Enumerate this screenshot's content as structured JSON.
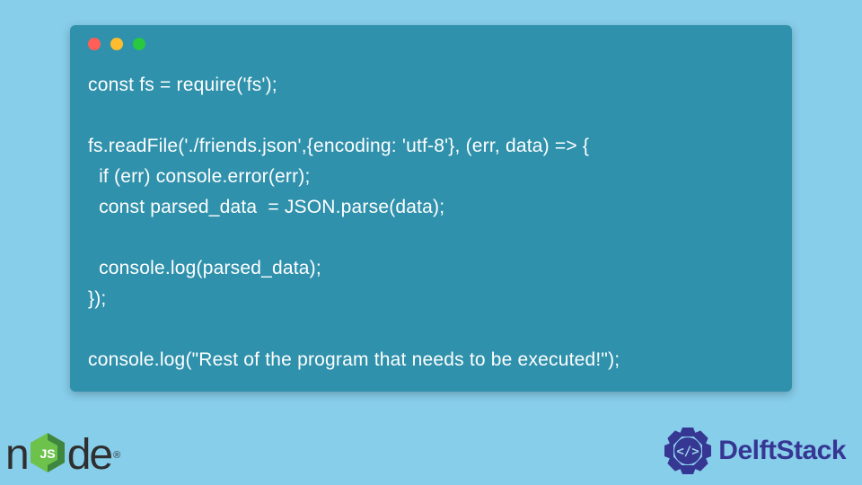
{
  "code": {
    "line1": "const fs = require('fs');",
    "line2": "",
    "line3": "fs.readFile('./friends.json',{encoding: 'utf-8'}, (err, data) => {",
    "line4": "  if (err) console.error(err);",
    "line5": "  const parsed_data  = JSON.parse(data);",
    "line6": "",
    "line7": "  console.log(parsed_data);",
    "line8": "});",
    "line9": "",
    "line10": "console.log(\"Rest of the program that needs to be executed!\");"
  },
  "logos": {
    "node_prefix": "n",
    "node_suffix": "de",
    "delft": "DelftStack"
  }
}
